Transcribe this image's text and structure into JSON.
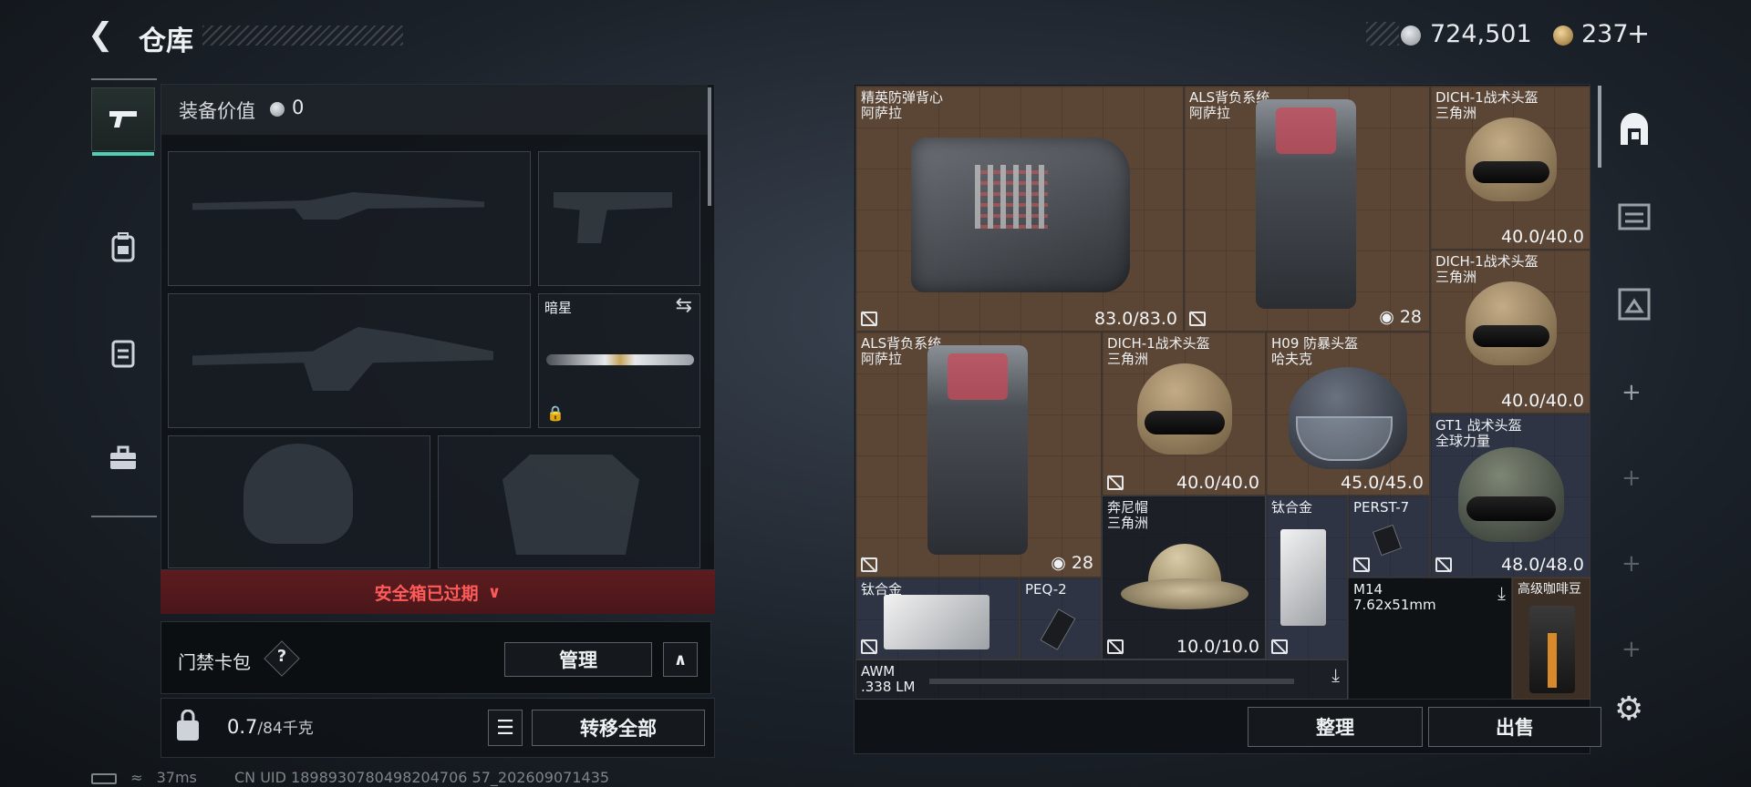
{
  "header": {
    "title": "仓库",
    "currency_silver": "724,501",
    "currency_gold": "237",
    "gold_add_symbol": "+"
  },
  "left_tabs": [
    {
      "name": "weapons",
      "icon": "pistol-icon"
    },
    {
      "name": "backpack",
      "icon": "backpack-icon"
    },
    {
      "name": "vest",
      "icon": "rig-icon"
    },
    {
      "name": "case",
      "icon": "case-icon"
    }
  ],
  "loadout": {
    "equipment_value_label": "装备价值",
    "equipment_value": "0",
    "melee_name": "暗星",
    "safebox_status": "安全箱已过期",
    "keycard_label": "门禁卡包",
    "keycard_help": "?",
    "manage_label": "管理",
    "weight_current": "0.7",
    "weight_max": "/84千克",
    "transfer_all_label": "转移全部"
  },
  "stash": {
    "items": [
      {
        "name": "精英防弹背心",
        "sub": "阿萨拉",
        "durability": "83.0/83.0"
      },
      {
        "name": "ALS背负系统",
        "sub": "阿萨拉",
        "capacity": "28"
      },
      {
        "name": "DICH-1战术头盔",
        "sub": "三角洲",
        "durability": "40.0/40.0"
      },
      {
        "name": "DICH-1战术头盔",
        "sub": "三角洲",
        "durability": "40.0/40.0"
      },
      {
        "name": "ALS背负系统",
        "sub": "阿萨拉",
        "capacity": "28"
      },
      {
        "name": "DICH-1战术头盔",
        "sub": "三角洲",
        "durability": "40.0/40.0"
      },
      {
        "name": "H09 防暴头盔",
        "sub": "哈夫克",
        "durability": "45.0/45.0"
      },
      {
        "name": "GT1 战术头盔",
        "sub": "全球力量",
        "durability": "48.0/48.0"
      },
      {
        "name": "奔尼帽",
        "sub": "三角洲",
        "durability": "10.0/10.0"
      },
      {
        "name": "钛合金"
      },
      {
        "name": "PERST-7"
      },
      {
        "name": "钛合金"
      },
      {
        "name": "PEQ-2"
      },
      {
        "name": "M14",
        "sub": "7.62x51mm"
      },
      {
        "name": "高级咖啡豆"
      },
      {
        "name": "AWM",
        "sub": ".338 LM"
      }
    ],
    "sort_label": "整理",
    "sell_label": "出售"
  },
  "status": {
    "ping": "37ms",
    "uid": "CN UID 1898930780498204706 57_202609071435"
  }
}
